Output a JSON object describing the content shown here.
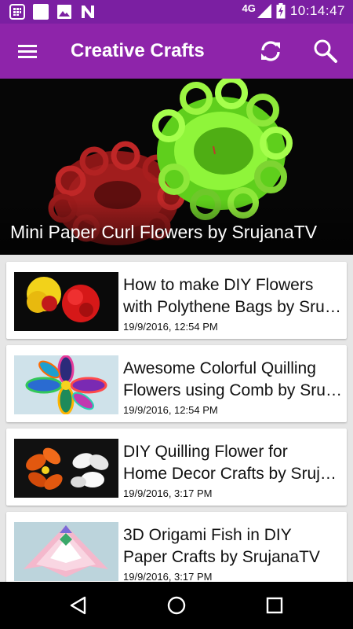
{
  "status_bar": {
    "network": "4G",
    "time": "10:14:47",
    "left_icons": [
      "notification-grid-icon",
      "blank-square-icon",
      "image-icon",
      "n-logo-icon"
    ],
    "right_icons": [
      "signal-icon",
      "battery-charging-icon"
    ]
  },
  "app_bar": {
    "title": "Creative Crafts",
    "icons": [
      "menu-icon",
      "refresh-icon",
      "search-icon"
    ],
    "color": "#8e24aa"
  },
  "featured": {
    "title": "Mini Paper Curl Flowers by SrujanaTV"
  },
  "videos": [
    {
      "title_line1": "How to make DIY Flowers",
      "title_line2": "with Polythene Bags by Srujana",
      "date": "19/9/2016, 12:54 PM"
    },
    {
      "title_line1": "Awesome Colorful Quilling",
      "title_line2": "Flowers using Comb by SrujanaTV",
      "date": "19/9/2016, 12:54 PM"
    },
    {
      "title_line1": "DIY Quilling Flower for",
      "title_line2": "Home Decor Crafts by SrujanaTV",
      "date": "19/9/2016, 3:17 PM"
    },
    {
      "title_line1": "3D Origami Fish in DIY",
      "title_line2": "Paper Crafts by SrujanaTV",
      "date": "19/9/2016, 3:17 PM"
    }
  ],
  "nav_bar": {
    "icons": [
      "back-icon",
      "home-icon",
      "recents-icon"
    ]
  }
}
